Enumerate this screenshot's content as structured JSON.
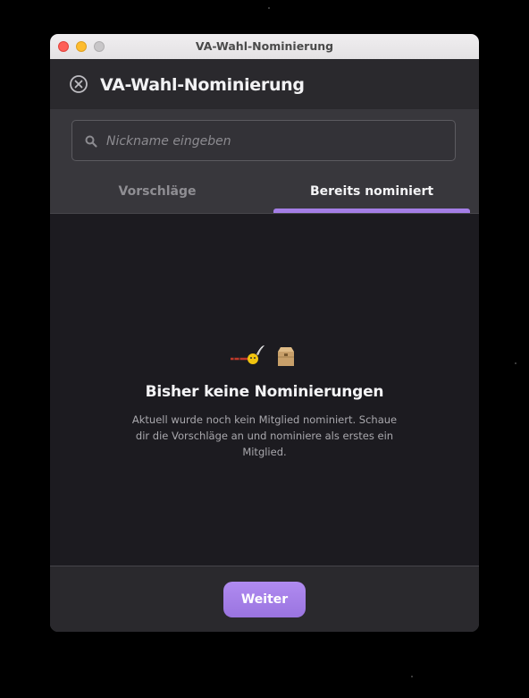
{
  "window": {
    "title": "VA-Wahl-Nominierung"
  },
  "header": {
    "close_icon": "circle-x-icon",
    "title": "VA-Wahl-Nominierung"
  },
  "search": {
    "icon": "search-icon",
    "placeholder": "Nickname eingeben",
    "value": ""
  },
  "tabs": [
    {
      "label": "Vorschläge",
      "active": false
    },
    {
      "label": "Bereits nominiert",
      "active": true
    }
  ],
  "empty_state": {
    "illustration": "feather-pen-and-ballot-box-icon",
    "title": "Bisher keine Nominierungen",
    "text": "Aktuell wurde noch kein Mitglied nominiert. Schaue dir die Vorschläge an und nominiere als erstes ein Mitglied."
  },
  "footer": {
    "next_label": "Weiter"
  },
  "colors": {
    "accent": "#a47ee6",
    "background": "#1c1b20",
    "header": "#2a292d"
  }
}
